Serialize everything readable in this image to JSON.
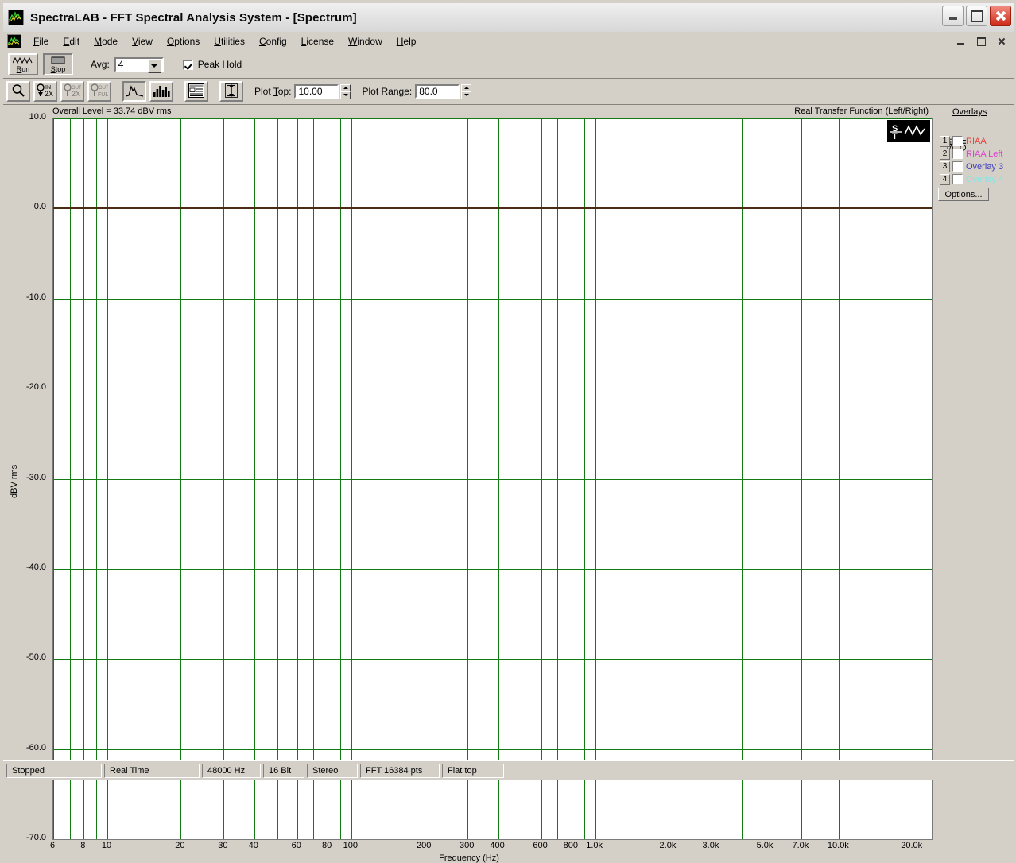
{
  "window": {
    "title": "SpectraLAB - FFT Spectral Analysis System - [Spectrum]",
    "icon": "spectralab-icon",
    "minimize": "minimize-icon",
    "maximize": "maximize-icon",
    "close": "close-icon"
  },
  "menu": {
    "items": [
      {
        "label": "File",
        "accel": "F"
      },
      {
        "label": "Edit",
        "accel": "E"
      },
      {
        "label": "Mode",
        "accel": "M"
      },
      {
        "label": "View",
        "accel": "V"
      },
      {
        "label": "Options",
        "accel": "O"
      },
      {
        "label": "Utilities",
        "accel": "U"
      },
      {
        "label": "Config",
        "accel": "C"
      },
      {
        "label": "License",
        "accel": "L"
      },
      {
        "label": "Window",
        "accel": "W"
      },
      {
        "label": "Help",
        "accel": "H"
      }
    ]
  },
  "toolbar": {
    "run_label": "Run",
    "stop_label": "Stop",
    "avg_label": "Avg:",
    "avg_value": "4",
    "peak_hold_label": "Peak Hold",
    "peak_hold_checked": true,
    "plot_top_label": "Plot Top:",
    "plot_top_value": "10.00",
    "plot_range_label": "Plot Range:",
    "plot_range_value": "80.0",
    "icons": [
      "zoom-icon",
      "zoom-in-2x-icon",
      "zoom-out-2x-icon",
      "zoom-out-full-icon",
      "spectrum-plot-icon",
      "bar-graph-icon",
      "data-table-icon",
      "plot-scale-icon"
    ]
  },
  "plot": {
    "overall_level": "Overall Level = 33.74 dBV rms",
    "mode_title": "Real Transfer Function (Left/Right)",
    "watermark": "st-logo-watermark"
  },
  "overlays": {
    "title": "Overlays",
    "col_set": "Set",
    "col_on": "On",
    "options_label": "Options...",
    "rows": [
      {
        "num": "1",
        "label": "RIAA",
        "color": "#e8423c",
        "checked": false
      },
      {
        "num": "2",
        "label": "RIAA Left",
        "color": "#e040d0",
        "checked": false
      },
      {
        "num": "3",
        "label": "Overlay 3",
        "color": "#4040c0",
        "checked": false
      },
      {
        "num": "4",
        "label": "Overlay 4",
        "color": "#7fe8e8",
        "checked": false
      }
    ]
  },
  "statusbar": {
    "cells": [
      {
        "text": "Stopped",
        "width": 120
      },
      {
        "text": "Real Time",
        "width": 120
      },
      {
        "text": "48000 Hz",
        "width": 74
      },
      {
        "text": "16 Bit",
        "width": 52
      },
      {
        "text": "Stereo",
        "width": 64
      },
      {
        "text": "FFT 16384 pts",
        "width": 100
      },
      {
        "text": "Flat top",
        "width": 78
      }
    ]
  },
  "chart_data": {
    "type": "line",
    "title": "Overall Level = 33.74 dBV rms",
    "subtitle": "Real Transfer Function (Left/Right)",
    "xlabel": "Frequency (Hz)",
    "ylabel": "dBV rms",
    "xscale": "log",
    "xlim": [
      6,
      24000
    ],
    "ylim": [
      -70,
      10
    ],
    "grid": true,
    "legend_position": "right",
    "y_ticks": [
      10.0,
      0.0,
      -10.0,
      -20.0,
      -30.0,
      -40.0,
      -50.0,
      -60.0,
      -70.0
    ],
    "y_tick_labels": [
      "10.0",
      "0.0",
      "-10.0",
      "-20.0",
      "-30.0",
      "-40.0",
      "-50.0",
      "-60.0",
      "-70.0"
    ],
    "x_ticks": [
      6,
      8,
      10,
      20,
      30,
      40,
      60,
      80,
      100,
      200,
      300,
      400,
      600,
      800,
      1000,
      2000,
      3000,
      5000,
      7000,
      10000,
      20000
    ],
    "x_tick_labels": [
      "6",
      "8",
      "10",
      "20",
      "30",
      "40",
      "60",
      "80",
      "100",
      "200",
      "300",
      "400",
      "600",
      "800",
      "1.0k",
      "2.0k",
      "3.0k",
      "5.0k",
      "7.0k",
      "10.0k",
      "20.0k"
    ],
    "x_gridlines": [
      6,
      7,
      8,
      9,
      10,
      20,
      30,
      40,
      50,
      60,
      70,
      80,
      90,
      100,
      200,
      300,
      400,
      500,
      600,
      700,
      800,
      900,
      1000,
      2000,
      3000,
      4000,
      5000,
      6000,
      7000,
      8000,
      9000,
      10000,
      20000
    ],
    "grid_color": "#127a12",
    "trace_color": "#4a2d10",
    "series": [
      {
        "name": "Transfer Function (Left/Right)",
        "color": "#4a2d10",
        "x": [
          6,
          10,
          20,
          50,
          100,
          200,
          500,
          1000,
          2000,
          5000,
          10000,
          20000
        ],
        "values": [
          0.0,
          0.0,
          0.0,
          0.0,
          0.0,
          0.0,
          0.0,
          0.0,
          0.0,
          0.0,
          0.0,
          0.0
        ]
      }
    ]
  }
}
